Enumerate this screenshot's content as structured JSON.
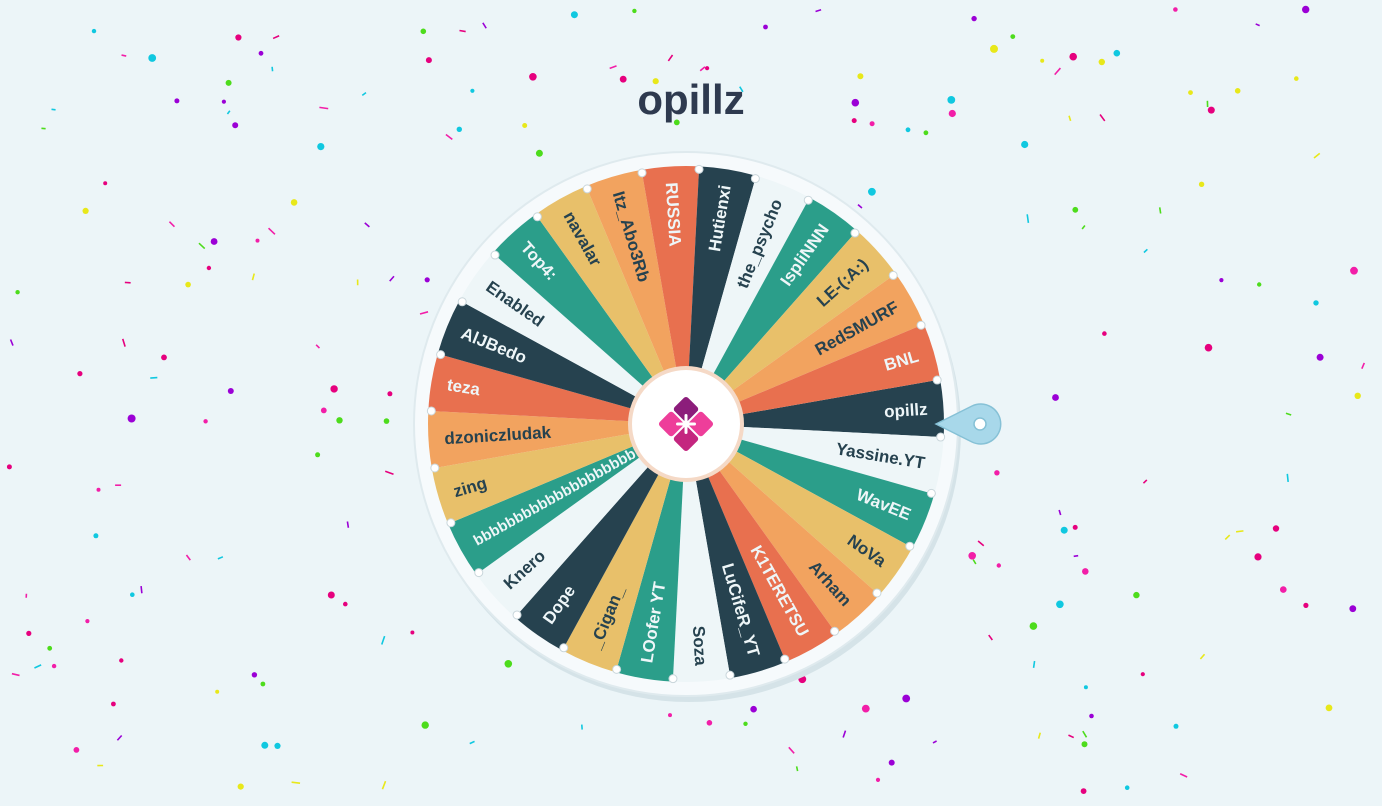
{
  "title": "opillz",
  "wheel": {
    "pointer_direction": "right",
    "colors": {
      "coral": "#e8704f",
      "dark": "#26424f",
      "light": "#eef6f8",
      "teal": "#2b9e8a",
      "sand": "#e8c06a",
      "peach": "#f2a35f",
      "logo_pink": "#ee3e9a",
      "logo_purple": "#8c1d7b",
      "pointer": "#a8d8ea",
      "rim": "#f6fafc"
    },
    "segments": [
      {
        "label": "opillz",
        "color": "dark",
        "text": "light"
      },
      {
        "label": "Yassine.YT",
        "color": "light",
        "text": "dark"
      },
      {
        "label": "WavEE",
        "color": "teal",
        "text": "light"
      },
      {
        "label": "NoVa",
        "color": "sand",
        "text": "dark"
      },
      {
        "label": "Arham",
        "color": "peach",
        "text": "dark"
      },
      {
        "label": "K1TERETSU",
        "color": "coral",
        "text": "light"
      },
      {
        "label": "LuCifeR_YT",
        "color": "dark",
        "text": "light"
      },
      {
        "label": "Soza",
        "color": "light",
        "text": "dark"
      },
      {
        "label": "LOofer YT",
        "color": "teal",
        "text": "light"
      },
      {
        "label": "_Cigan_",
        "color": "sand",
        "text": "dark"
      },
      {
        "label": "Dope",
        "color": "dark",
        "text": "light"
      },
      {
        "label": "Knero",
        "color": "light",
        "text": "dark"
      },
      {
        "label": "bbbbbbbbbbbbbbbbbbbbb",
        "color": "teal",
        "text": "light"
      },
      {
        "label": "zing",
        "color": "sand",
        "text": "dark"
      },
      {
        "label": "dzoniczludak",
        "color": "peach",
        "text": "dark"
      },
      {
        "label": "teza",
        "color": "coral",
        "text": "light"
      },
      {
        "label": "AlJBedo",
        "color": "dark",
        "text": "light"
      },
      {
        "label": "Enabled",
        "color": "light",
        "text": "dark"
      },
      {
        "label": "Top4:",
        "color": "teal",
        "text": "light"
      },
      {
        "label": "navalar",
        "color": "sand",
        "text": "dark"
      },
      {
        "label": "Itz_Abo3Rb",
        "color": "peach",
        "text": "dark"
      },
      {
        "label": "RUSSIA",
        "color": "coral",
        "text": "light"
      },
      {
        "label": "Hutienxi",
        "color": "dark",
        "text": "light"
      },
      {
        "label": "the_psycho",
        "color": "light",
        "text": "dark"
      },
      {
        "label": "IspliNNN",
        "color": "teal",
        "text": "light"
      },
      {
        "label": "LE-(:A:)",
        "color": "sand",
        "text": "dark"
      },
      {
        "label": "RedSMURF",
        "color": "peach",
        "text": "dark"
      },
      {
        "label": "BNL",
        "color": "coral",
        "text": "light"
      }
    ]
  },
  "confetti_colors": [
    "#e6007e",
    "#9b00d6",
    "#e8e81a",
    "#4ddc1c",
    "#10c8e0",
    "#f21ea8"
  ]
}
